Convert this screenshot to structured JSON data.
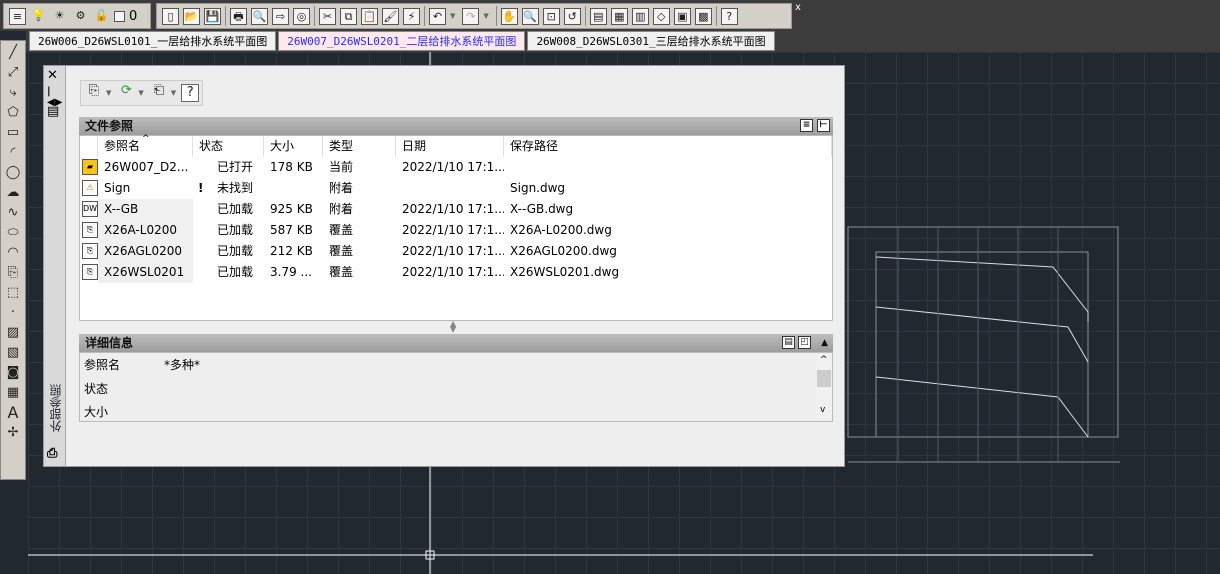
{
  "tabs": [
    {
      "label": "26W006_D26WSL0101_一层给排水系统平面图"
    },
    {
      "label": "26W007_D26WSL0201_二层给排水系统平面图"
    },
    {
      "label": "26W008_D26WSL0301_三层给排水系统平面图"
    }
  ],
  "layer_value": "0",
  "palette": {
    "vertical_title": "外部参照",
    "file_ref_title": "文件参照",
    "columns": [
      "参照名",
      "状态",
      "大小",
      "类型",
      "日期",
      "保存路径"
    ],
    "rows": [
      {
        "name": "26W007_D2...",
        "flag": "",
        "status": "已打开",
        "size": "178 KB",
        "type": "当前",
        "date": "2022/1/10 17:1...",
        "path": "",
        "icon": "drawing-icon"
      },
      {
        "name": "Sign",
        "flag": "!",
        "status": "未找到",
        "size": "",
        "type": "附着",
        "date": "",
        "path": "Sign.dwg",
        "icon": "dwg-warning-icon"
      },
      {
        "name": "X--GB",
        "flag": "",
        "status": "已加载",
        "size": "925 KB",
        "type": "附着",
        "date": "2022/1/10 17:1...",
        "path": "X--GB.dwg",
        "icon": "dwg-icon"
      },
      {
        "name": "X26A-L0200",
        "flag": "",
        "status": "已加载",
        "size": "587 KB",
        "type": "覆盖",
        "date": "2022/1/10 17:1...",
        "path": "X26A-L0200.dwg",
        "icon": "xref-icon"
      },
      {
        "name": "X26AGL0200",
        "flag": "",
        "status": "已加载",
        "size": "212 KB",
        "type": "覆盖",
        "date": "2022/1/10 17:1...",
        "path": "X26AGL0200.dwg",
        "icon": "xref-icon"
      },
      {
        "name": "X26WSL0201",
        "flag": "",
        "status": "已加载",
        "size": "3.79 ...",
        "type": "覆盖",
        "date": "2022/1/10 17:1...",
        "path": "X26WSL0201.dwg",
        "icon": "xref-icon"
      }
    ],
    "details_title": "详细信息",
    "details": [
      {
        "label": "参照名",
        "value": "*多种*"
      },
      {
        "label": "状态",
        "value": ""
      },
      {
        "label": "大小",
        "value": ""
      }
    ]
  }
}
